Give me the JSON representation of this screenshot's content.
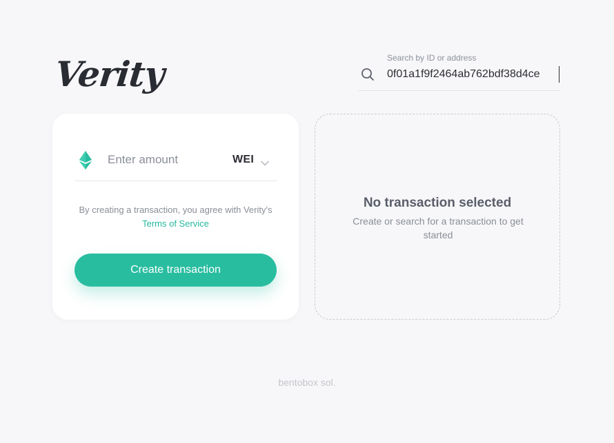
{
  "brand": {
    "logo_text": "Verity"
  },
  "search": {
    "label": "Search by ID or address",
    "value": "0f01a1f9f2464ab762bdf38d4ce",
    "icon": "search-icon"
  },
  "create_card": {
    "amount": {
      "placeholder": "Enter amount",
      "value": "",
      "icon": "ethereum-icon"
    },
    "unit": {
      "selected": "WEI",
      "icon": "chevron-down-icon"
    },
    "terms": {
      "prefix": "By creating a transaction, you agree with Verity's",
      "link_text": "Terms of Service"
    },
    "submit_label": "Create transaction"
  },
  "detail_panel": {
    "title": "No transaction selected",
    "subtitle": "Create or search for a transaction to get started"
  },
  "footer": {
    "text": "bentobox sol."
  },
  "colors": {
    "accent": "#29bda0",
    "background": "#f7f7f9",
    "card": "#ffffff",
    "muted_text": "#8a8e97",
    "footer_text": "#c4c6cc"
  }
}
